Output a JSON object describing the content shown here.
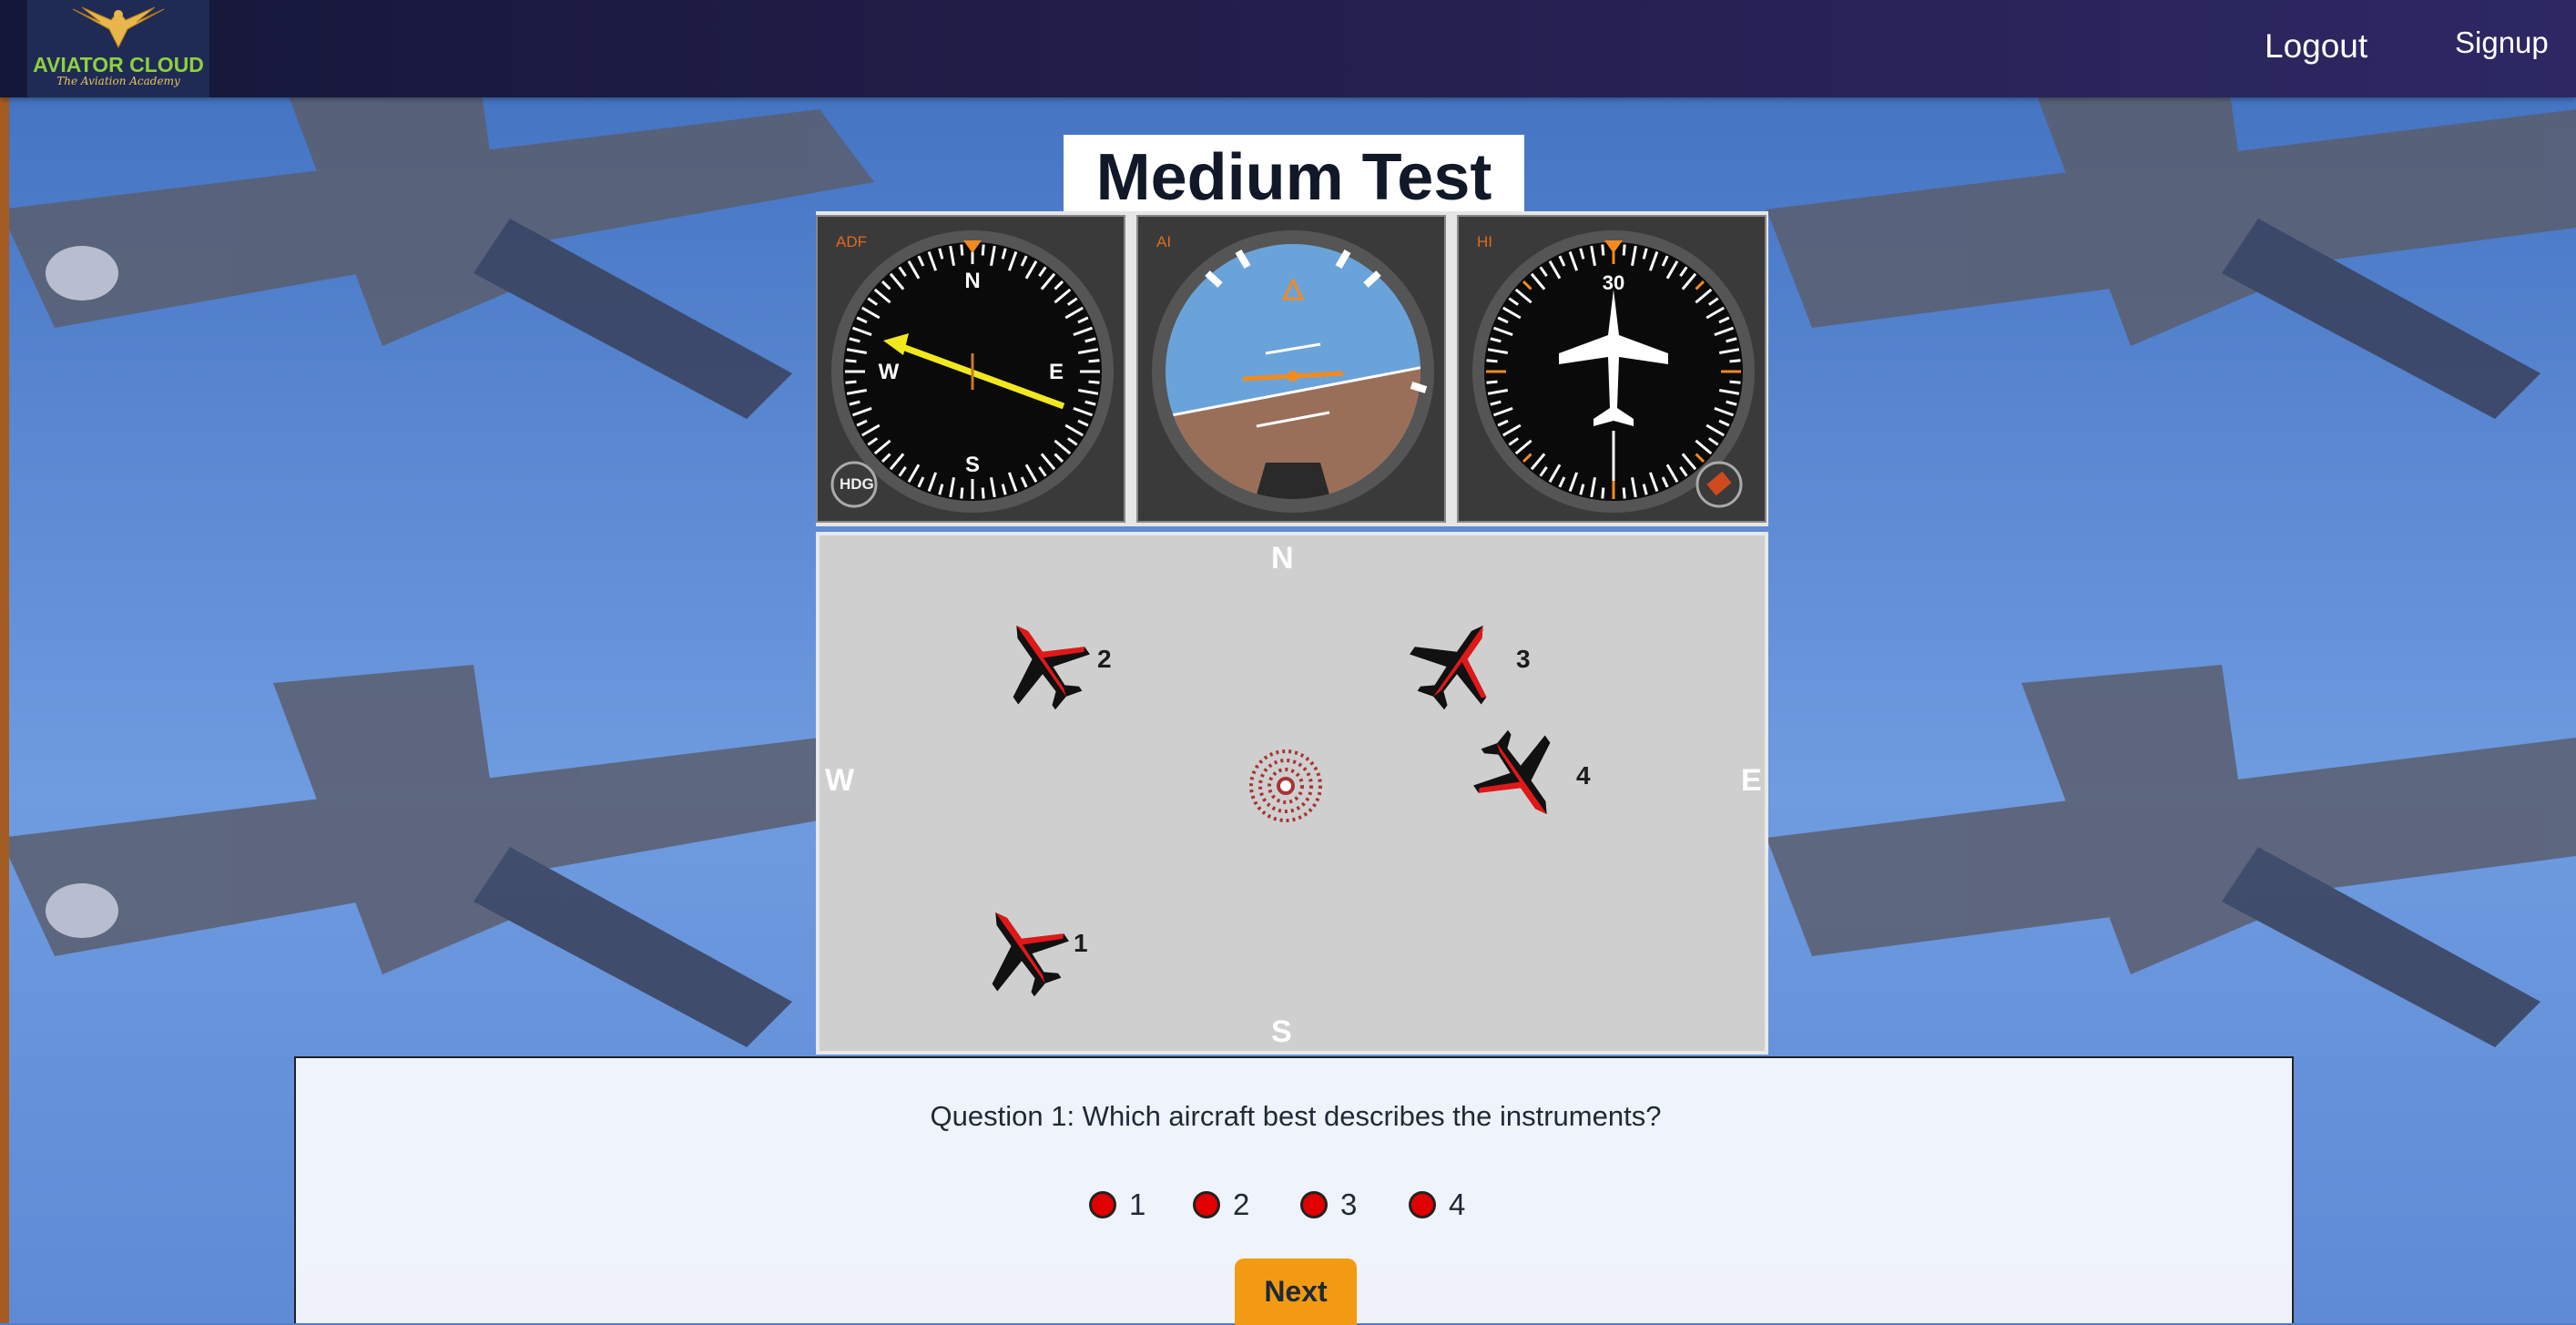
{
  "header": {
    "logo_title": "AVIATOR CLOUD",
    "logo_subtitle": "The Aviation Academy",
    "logout_label": "Logout",
    "signup_label": "Signup"
  },
  "test": {
    "title": "Medium Test"
  },
  "instruments": {
    "adf_label": "ADF",
    "ai_label": "AI",
    "hi_label": "HI",
    "hdg_knob": "HDG"
  },
  "map": {
    "north": "N",
    "south": "S",
    "west": "W",
    "east": "E",
    "aircraft": [
      "1",
      "2",
      "3",
      "4"
    ]
  },
  "question": {
    "text": "Question 1: Which aircraft best describes the instruments?",
    "options": [
      "1",
      "2",
      "3",
      "4"
    ],
    "next_label": "Next"
  },
  "colors": {
    "nav": "#221e4a",
    "accent_button": "#f29b12",
    "radio": "#e00000",
    "sky": "#4f7fc9"
  }
}
